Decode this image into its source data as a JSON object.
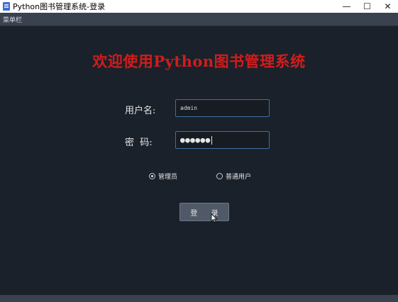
{
  "window": {
    "title": "Python图书管理系统-登录",
    "controls": {
      "minimize": "—",
      "maximize": "☐",
      "close": "✕"
    }
  },
  "menubar": {
    "label": "菜单栏"
  },
  "login": {
    "heading": "欢迎使用Python图书管理系统",
    "username_label": "用户名:",
    "username_value": "admin",
    "password_label": "密  码:",
    "password_masked": "●●●●●●",
    "roles": [
      {
        "label": "管理员",
        "selected": true
      },
      {
        "label": "普通用户",
        "selected": false
      }
    ],
    "login_button": "登 录"
  },
  "colors": {
    "background": "#1b212a",
    "heading": "#d21c1c",
    "input_border": "#3b6fa8",
    "button": "#4f5968"
  },
  "icons": {
    "app": "app-icon",
    "cursor": "mouse-pointer-icon"
  }
}
